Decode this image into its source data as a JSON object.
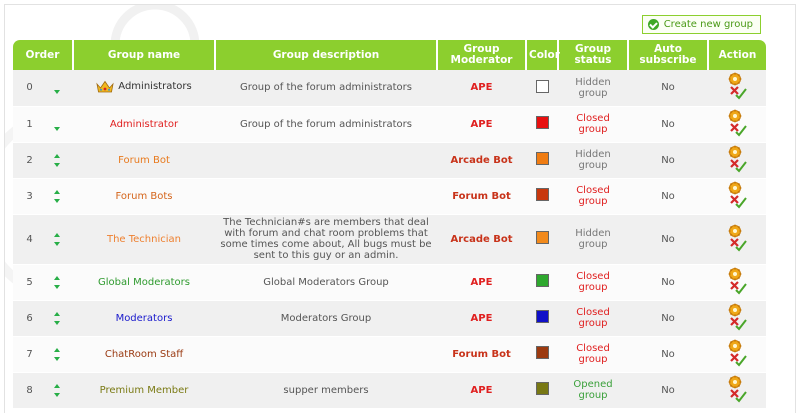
{
  "toolbar": {
    "create_label": "Create new group",
    "create_icon": "check-circle-icon"
  },
  "columns": {
    "order": "Order",
    "group_name": "Group name",
    "group_description": "Group description",
    "group_moderator": "Group Moderator",
    "color": "Color",
    "group_status": "Group status",
    "auto_subscribe": "Auto subscribe",
    "action": "Action"
  },
  "rows": [
    {
      "order": "0",
      "name": "Administrators",
      "name_color": "#333333",
      "has_crown": true,
      "up": false,
      "down": true,
      "description": "Group of the forum administrators",
      "moderator": "APE",
      "moderator_color": "#e02020",
      "color": "#ffffff",
      "status": "Hidden group",
      "status_color": "#777777",
      "auto_subscribe": "No"
    },
    {
      "order": "1",
      "name": "Administrator",
      "name_color": "#e02020",
      "has_crown": false,
      "up": false,
      "down": true,
      "description": "Group of the forum administrators",
      "moderator": "APE",
      "moderator_color": "#e02020",
      "color": "#e81010",
      "status": "Closed group",
      "status_color": "#e02020",
      "auto_subscribe": "No"
    },
    {
      "order": "2",
      "name": "Forum Bot",
      "name_color": "#e87a1e",
      "has_crown": false,
      "up": true,
      "down": true,
      "description": "",
      "moderator": "Arcade Bot",
      "moderator_color": "#c8331a",
      "color": "#f07c12",
      "status": "Hidden group",
      "status_color": "#777777",
      "auto_subscribe": "No"
    },
    {
      "order": "3",
      "name": "Forum Bots",
      "name_color": "#d4641a",
      "has_crown": false,
      "up": true,
      "down": true,
      "description": "",
      "moderator": "Forum Bot",
      "moderator_color": "#c8331a",
      "color": "#c8380e",
      "status": "Closed group",
      "status_color": "#e02020",
      "auto_subscribe": "No"
    },
    {
      "order": "4",
      "name": "The Technician",
      "name_color": "#ee8030",
      "has_crown": false,
      "up": true,
      "down": true,
      "description": "The Technician#s are members that deal with forum and chat room problems that some times come about, All bugs must be sent to this guy or an admin.",
      "moderator": "Arcade Bot",
      "moderator_color": "#c8331a",
      "color": "#f28a1c",
      "status": "Hidden group",
      "status_color": "#777777",
      "auto_subscribe": "No"
    },
    {
      "order": "5",
      "name": "Global Moderators",
      "name_color": "#2e9a2e",
      "has_crown": false,
      "up": true,
      "down": true,
      "description": "Global Moderators Group",
      "moderator": "APE",
      "moderator_color": "#e02020",
      "color": "#2ea82e",
      "status": "Closed group",
      "status_color": "#e02020",
      "auto_subscribe": "No"
    },
    {
      "order": "6",
      "name": "Moderators",
      "name_color": "#1a1acc",
      "has_crown": false,
      "up": true,
      "down": true,
      "description": "Moderators Group",
      "moderator": "APE",
      "moderator_color": "#e02020",
      "color": "#1010c8",
      "status": "Closed group",
      "status_color": "#e02020",
      "auto_subscribe": "No"
    },
    {
      "order": "7",
      "name": "ChatRoom Staff",
      "name_color": "#9a3a12",
      "has_crown": false,
      "up": true,
      "down": true,
      "description": "",
      "moderator": "Forum Bot",
      "moderator_color": "#c8331a",
      "color": "#9c3a10",
      "status": "Closed group",
      "status_color": "#e02020",
      "auto_subscribe": "No"
    },
    {
      "order": "8",
      "name": "Premium Member",
      "name_color": "#7a7a14",
      "has_crown": false,
      "up": true,
      "down": true,
      "description": "supper members",
      "moderator": "APE",
      "moderator_color": "#e02020",
      "color": "#787814",
      "status": "Opened group",
      "status_color": "#3aa03a",
      "auto_subscribe": "No"
    }
  ],
  "icons": {
    "edit": "gear-edit-icon",
    "delete": "delete-icon",
    "crown": "crown-icon"
  },
  "accent": "#8ccf2e"
}
